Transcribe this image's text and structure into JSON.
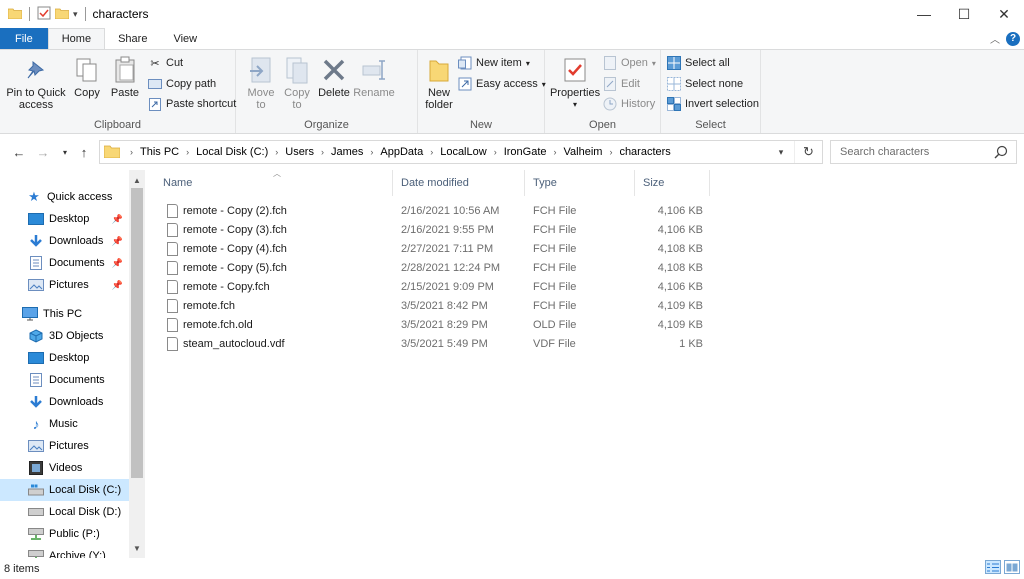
{
  "window": {
    "title": "characters",
    "controls": {
      "minimize": "—",
      "maximize": "☐",
      "close": "✕"
    }
  },
  "ribbon_tabs": [
    "File",
    "Home",
    "Share",
    "View"
  ],
  "ribbon": {
    "clipboard": {
      "label": "Clipboard",
      "pin_to_quick_access": "Pin to Quick access",
      "copy": "Copy",
      "paste": "Paste",
      "cut": "Cut",
      "copy_path": "Copy path",
      "paste_shortcut": "Paste shortcut"
    },
    "organize": {
      "label": "Organize",
      "move_to": "Move to",
      "copy_to": "Copy to",
      "delete": "Delete",
      "rename": "Rename"
    },
    "new": {
      "label": "New",
      "new_folder": "New folder",
      "new_item": "New item",
      "easy_access": "Easy access"
    },
    "open": {
      "label": "Open",
      "properties": "Properties",
      "open": "Open",
      "edit": "Edit",
      "history": "History"
    },
    "select": {
      "label": "Select",
      "select_all": "Select all",
      "select_none": "Select none",
      "invert_selection": "Invert selection"
    }
  },
  "address": {
    "crumbs": [
      "This PC",
      "Local Disk (C:)",
      "Users",
      "James",
      "AppData",
      "LocalLow",
      "IronGate",
      "Valheim",
      "characters"
    ]
  },
  "search": {
    "placeholder": "Search characters"
  },
  "nav_pane": {
    "quick_access": "Quick access",
    "quick_items": [
      "Desktop",
      "Downloads",
      "Documents",
      "Pictures"
    ],
    "this_pc": "This PC",
    "pc_items": [
      "3D Objects",
      "Desktop",
      "Documents",
      "Downloads",
      "Music",
      "Pictures",
      "Videos",
      "Local Disk (C:)",
      "Local Disk (D:)",
      "Public (P:)",
      "Archive (Y:)"
    ]
  },
  "columns": {
    "name": "Name",
    "date": "Date modified",
    "type": "Type",
    "size": "Size"
  },
  "files": [
    {
      "name": "remote - Copy (2).fch",
      "date": "2/16/2021 10:56 AM",
      "type": "FCH File",
      "size": "4,106 KB"
    },
    {
      "name": "remote - Copy (3).fch",
      "date": "2/16/2021 9:55 PM",
      "type": "FCH File",
      "size": "4,106 KB"
    },
    {
      "name": "remote - Copy (4).fch",
      "date": "2/27/2021 7:11 PM",
      "type": "FCH File",
      "size": "4,108 KB"
    },
    {
      "name": "remote - Copy (5).fch",
      "date": "2/28/2021 12:24 PM",
      "type": "FCH File",
      "size": "4,108 KB"
    },
    {
      "name": "remote - Copy.fch",
      "date": "2/15/2021 9:09 PM",
      "type": "FCH File",
      "size": "4,106 KB"
    },
    {
      "name": "remote.fch",
      "date": "3/5/2021 8:42 PM",
      "type": "FCH File",
      "size": "4,109 KB"
    },
    {
      "name": "remote.fch.old",
      "date": "3/5/2021 8:29 PM",
      "type": "OLD File",
      "size": "4,109 KB"
    },
    {
      "name": "steam_autocloud.vdf",
      "date": "3/5/2021 5:49 PM",
      "type": "VDF File",
      "size": "1 KB"
    }
  ],
  "status": {
    "items": "8 items"
  },
  "colors": {
    "accent": "#1a6fbf",
    "selection": "#cce8ff",
    "folder": "#f8d775"
  }
}
